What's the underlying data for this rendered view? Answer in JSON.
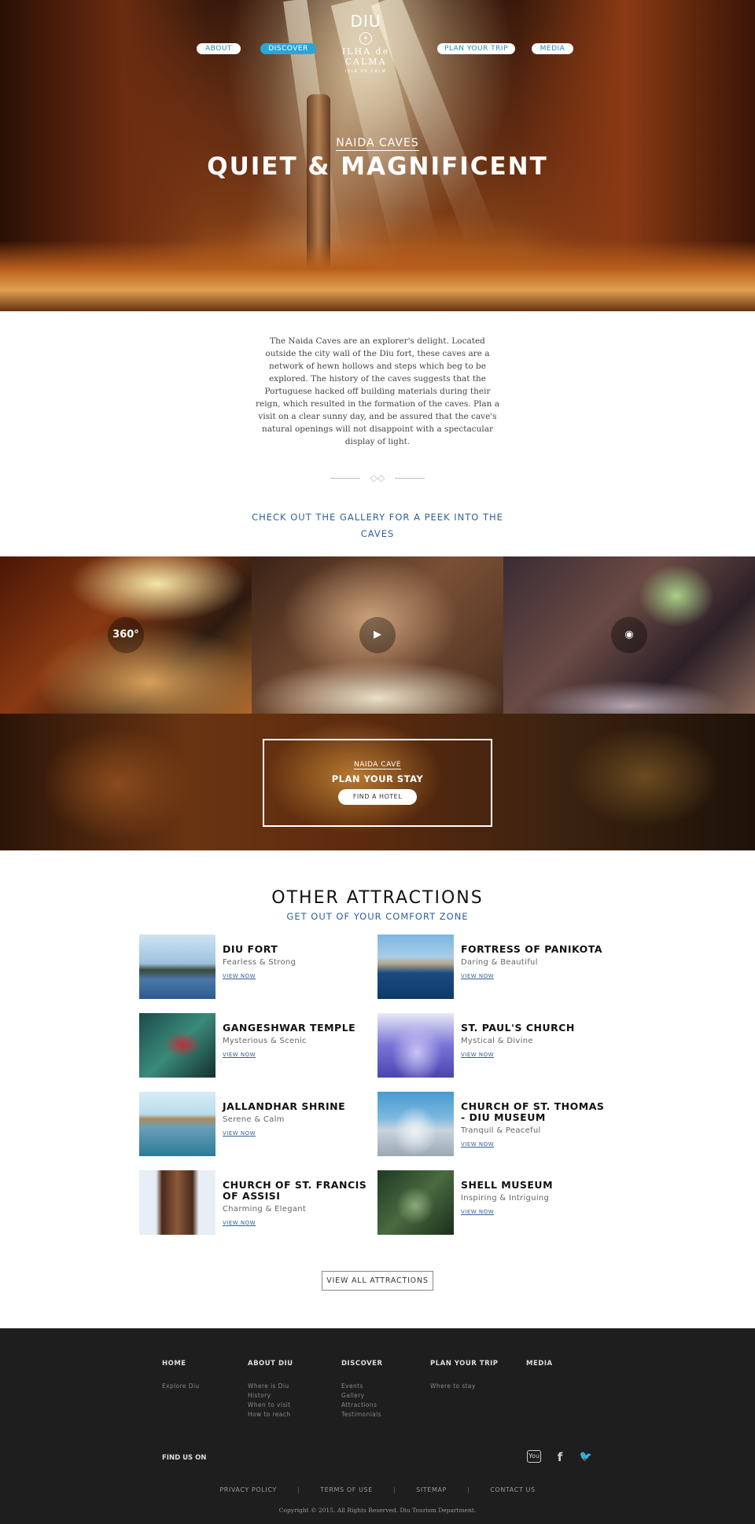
{
  "nav": {
    "items": [
      {
        "label": "ABOUT",
        "active": false
      },
      {
        "label": "DISCOVER",
        "active": true
      },
      {
        "label": "PLAN YOUR TRIP",
        "active": false
      },
      {
        "label": "MEDIA",
        "active": false
      }
    ]
  },
  "logo": {
    "name": "DIU",
    "tagline": "ILHA de CALMA",
    "subtitle": "ISLE OF CALM"
  },
  "hero": {
    "subtitle": "NAIDA CAVES",
    "title": "QUIET & MAGNIFICENT"
  },
  "intro": {
    "text": "The Naida Caves are an explorer's delight. Located outside the city wall of the Diu fort, these caves are a network of hewn hollows and steps which beg to be explored. The history of the caves suggests that the Portuguese hacked off building materials during their reign, which resulted in the formation of the caves. Plan a visit on a clear sunny day, and be assured that the cave's natural openings will not disappoint with a spectacular display of light.",
    "gallery_cta": "CHECK OUT THE GALLERY FOR A PEEK INTO THE CAVES"
  },
  "gallery": {
    "tiles": [
      {
        "icon": "360-icon",
        "icon_text": "360°"
      },
      {
        "icon": "play-icon",
        "icon_text": "▶"
      },
      {
        "icon": "eye-icon",
        "icon_text": "◉"
      }
    ]
  },
  "stay": {
    "subtitle": "NAIDA CAVE",
    "title": "PLAN YOUR STAY",
    "button": "FIND A HOTEL"
  },
  "attractions": {
    "title": "OTHER ATTRACTIONS",
    "subtitle": "GET OUT OF YOUR COMFORT ZONE",
    "link_label": "VIEW NOW",
    "items": [
      {
        "title": "DIU FORT",
        "tagline": "Fearless & Strong"
      },
      {
        "title": "FORTRESS OF PANIKOTA",
        "tagline": "Daring & Beautiful"
      },
      {
        "title": "GANGESHWAR TEMPLE",
        "tagline": "Mysterious & Scenic"
      },
      {
        "title": "ST. PAUL'S CHURCH",
        "tagline": "Mystical & Divine"
      },
      {
        "title": "JALLANDHAR SHRINE",
        "tagline": "Serene & Calm"
      },
      {
        "title": "CHURCH OF ST. THOMAS - DIU MUSEUM",
        "tagline": "Tranquil & Peaceful"
      },
      {
        "title": "CHURCH OF ST. FRANCIS OF ASSISI",
        "tagline": "Charming & Elegant"
      },
      {
        "title": "SHELL MUSEUM",
        "tagline": "Inspiring & Intriguing"
      }
    ],
    "view_all": "VIEW ALL ATTRACTIONS"
  },
  "footer": {
    "columns": [
      {
        "heading": "HOME",
        "links": [
          "Explore Diu"
        ]
      },
      {
        "heading": "ABOUT DIU",
        "links": [
          "Where is Diu",
          "History",
          "When to visit",
          "How to reach"
        ]
      },
      {
        "heading": "DISCOVER",
        "links": [
          "Events",
          "Gallery",
          "Attractions",
          "Testimonials"
        ]
      },
      {
        "heading": "PLAN YOUR TRIP",
        "links": [
          "Where to stay"
        ]
      },
      {
        "heading": "MEDIA",
        "links": []
      }
    ],
    "find_us": "FIND US ON",
    "social": [
      {
        "icon": "youtube-icon",
        "glyph": "You"
      },
      {
        "icon": "facebook-icon",
        "glyph": "f"
      },
      {
        "icon": "twitter-icon",
        "glyph": "🐦"
      }
    ],
    "legal": [
      "PRIVACY POLICY",
      "TERMS OF USE",
      "SITEMAP",
      "CONTACT US"
    ],
    "copyright": "Copyright © 2015. All Rights Reserved. Diu Tourism Department."
  },
  "colors": {
    "accent": "#2aa6d4",
    "link": "#2f5f9a",
    "footer_bg": "#1e1e1e"
  }
}
